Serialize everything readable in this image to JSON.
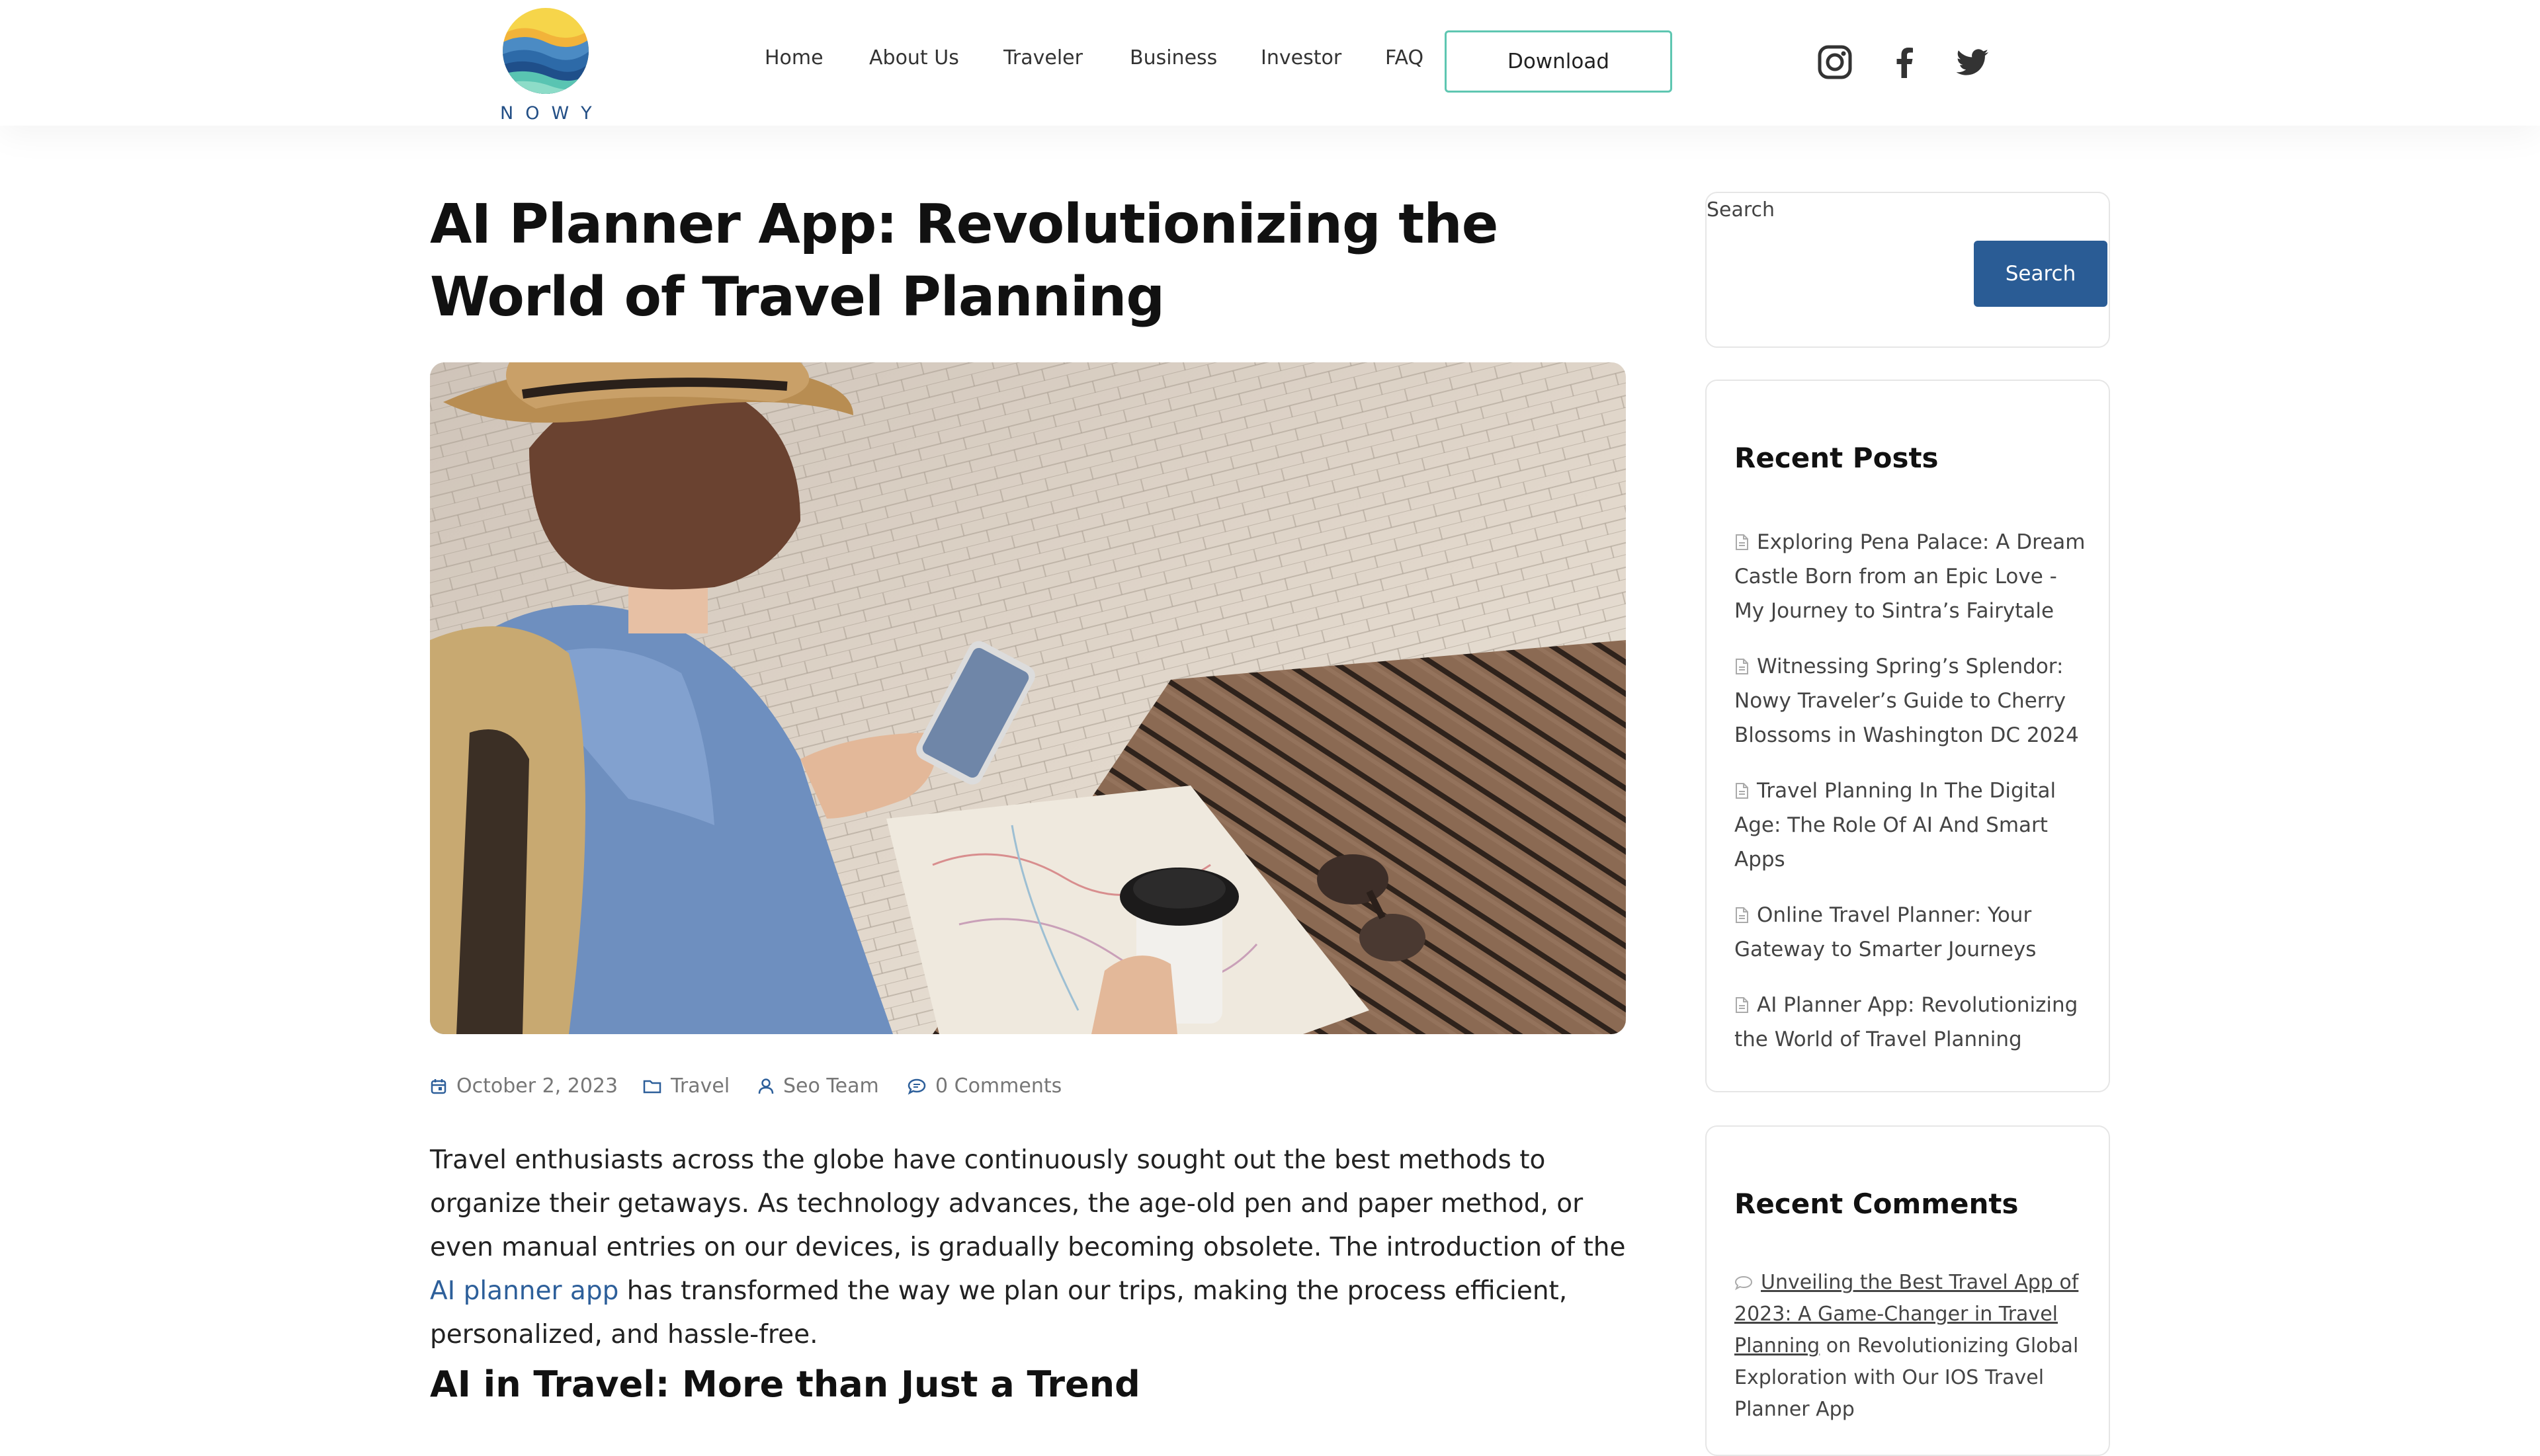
{
  "brand": {
    "name": "NOWY"
  },
  "nav": {
    "items": [
      {
        "label": "Home"
      },
      {
        "label": "About Us"
      },
      {
        "label": "Traveler"
      },
      {
        "label": "Business"
      },
      {
        "label": "Investor"
      },
      {
        "label": "FAQ"
      }
    ],
    "download_label": "Download",
    "social": [
      "instagram-icon",
      "facebook-icon",
      "twitter-icon"
    ]
  },
  "post": {
    "title": "AI Planner App: Revolutionizing the World of Travel Planning",
    "meta": {
      "date": "October 2, 2023",
      "category": "Travel",
      "author": "Seo Team",
      "comments": "0 Comments"
    },
    "intro_before_link": "Travel enthusiasts across the globe have continuously sought out the best methods to organize their getaways. As technology advances, the age-old pen and paper method, or even manual entries on our devices, is gradually becoming obsolete. The introduction of the ",
    "intro_link": "AI planner app",
    "intro_after_link": " has transformed the way we plan our trips, making the process efficient, personalized, and hassle-free.",
    "section_heading": "AI in Travel: More than Just a Trend"
  },
  "sidebar": {
    "search": {
      "label": "Search",
      "placeholder": "",
      "button_label": "Search"
    },
    "recent_posts": {
      "title": "Recent Posts",
      "items": [
        {
          "label": "Exploring Pena Palace: A Dream Castle Born from an Epic Love - My Journey to Sintra’s Fairytale"
        },
        {
          "label": "Witnessing Spring’s Splendor: Nowy Traveler’s Guide to Cherry Blossoms in Washington DC 2024"
        },
        {
          "label": "Travel Planning In The Digital Age: The Role Of AI And Smart Apps"
        },
        {
          "label": "Online Travel Planner: Your Gateway to Smarter Journeys"
        },
        {
          "label": "AI Planner App: Revolutionizing the World of Travel Planning"
        }
      ]
    },
    "recent_comments": {
      "title": "Recent Comments",
      "items": [
        {
          "link": "Unveiling the Best Travel App of 2023: A Game-Changer in Travel Planning",
          "connector": " on ",
          "post": "Revolutionizing Global Exploration with Our IOS Travel Planner App"
        }
      ]
    }
  },
  "colors": {
    "accent_blue": "#2a5c95",
    "link_blue": "#2d5f9a",
    "download_border": "#5ec6b1",
    "logo_text": "#234f86"
  }
}
